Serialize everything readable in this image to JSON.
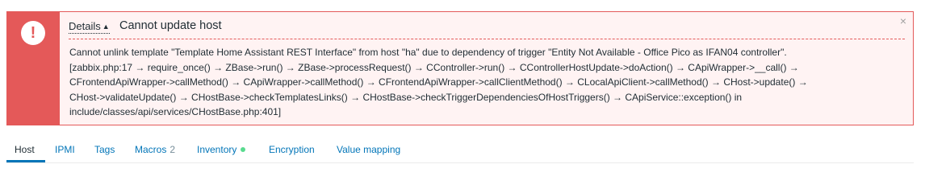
{
  "message": {
    "details_label": "Details",
    "details_arrow": "▲",
    "title": "Cannot update host",
    "icon_glyph": "!",
    "icon": "exclamation-icon",
    "close_glyph": "×",
    "close_icon": "close-icon",
    "details_lines": [
      "Cannot unlink template \"Template Home Assistant REST Interface\" from host \"ha\" due to dependency of trigger \"Entity Not Available - Office Pico as IFAN04 controller\".",
      "[zabbix.php:17 → require_once() → ZBase->run() → ZBase->processRequest() → CController->run() → CControllerHostUpdate->doAction() → CApiWrapper->__call() →",
      "CFrontendApiWrapper->callMethod() → CApiWrapper->callMethod() → CFrontendApiWrapper->callClientMethod() → CLocalApiClient->callMethod() → CHost->update() →",
      "CHost->validateUpdate() → CHostBase->checkTemplatesLinks() → CHostBase->checkTriggerDependenciesOfHostTriggers() → CApiService::exception() in",
      "include/classes/api/services/CHostBase.php:401]"
    ],
    "colors": {
      "error": "#e45959",
      "background": "#fff3f3"
    }
  },
  "tabs": [
    {
      "label": "Host",
      "active": true
    },
    {
      "label": "IPMI"
    },
    {
      "label": "Tags"
    },
    {
      "label": "Macros",
      "count": "2"
    },
    {
      "label": "Inventory",
      "status_color": "#59db8f"
    },
    {
      "label": "Encryption"
    },
    {
      "label": "Value mapping"
    }
  ],
  "colors": {
    "link": "#0275b8",
    "text": "#1f2c33"
  }
}
